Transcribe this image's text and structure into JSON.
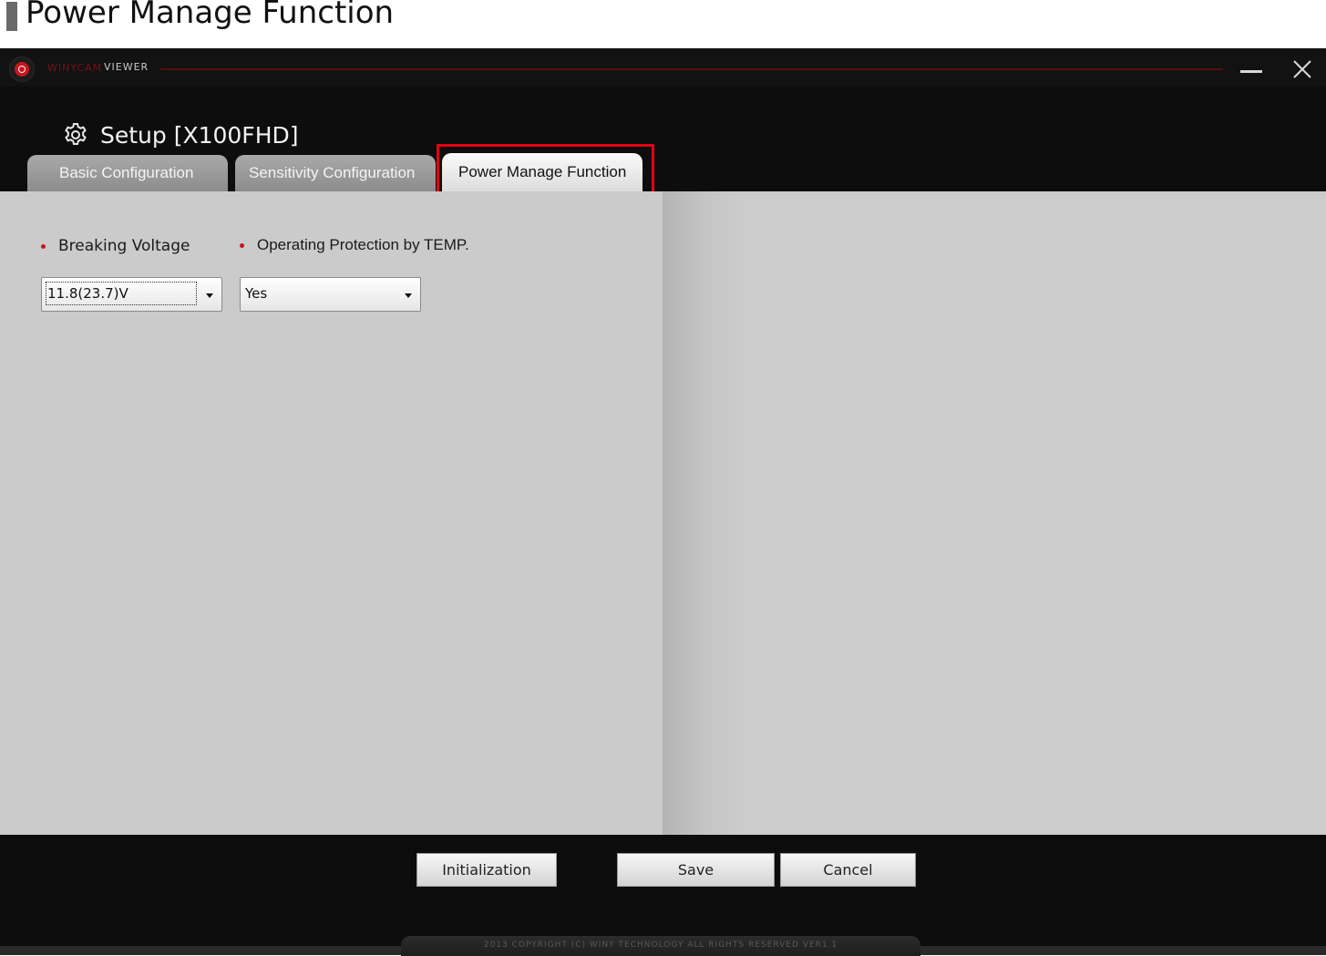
{
  "doc_heading": {
    "text": "Power Manage Function"
  },
  "titlebar": {
    "brand": "WINYCAM",
    "app_name": "VIEWER"
  },
  "setup": {
    "title": "Setup [X100FHD]"
  },
  "tabs": [
    {
      "label": "Basic Configuration",
      "active": false
    },
    {
      "label": "Sensitivity Configuration",
      "active": false
    },
    {
      "label": "Power Manage Function",
      "active": true
    }
  ],
  "fields": {
    "breaking_voltage": {
      "label": "Breaking Voltage",
      "value": "11.8(23.7)V"
    },
    "operating_protection": {
      "label": "Operating Protection by TEMP.",
      "value": "Yes"
    }
  },
  "buttons": {
    "initialization": "Initialization",
    "save": "Save",
    "cancel": "Cancel"
  },
  "footer": {
    "copyright": "2013 COPYRIGHT (C) WINY TECHNOLOGY ALL RIGHTS RESERVED VER1.1"
  },
  "colors": {
    "highlight": "#e60012",
    "brand_red": "#c8161e",
    "bullet_red": "#c4161c",
    "panel_gray": "#cbcbcb"
  }
}
